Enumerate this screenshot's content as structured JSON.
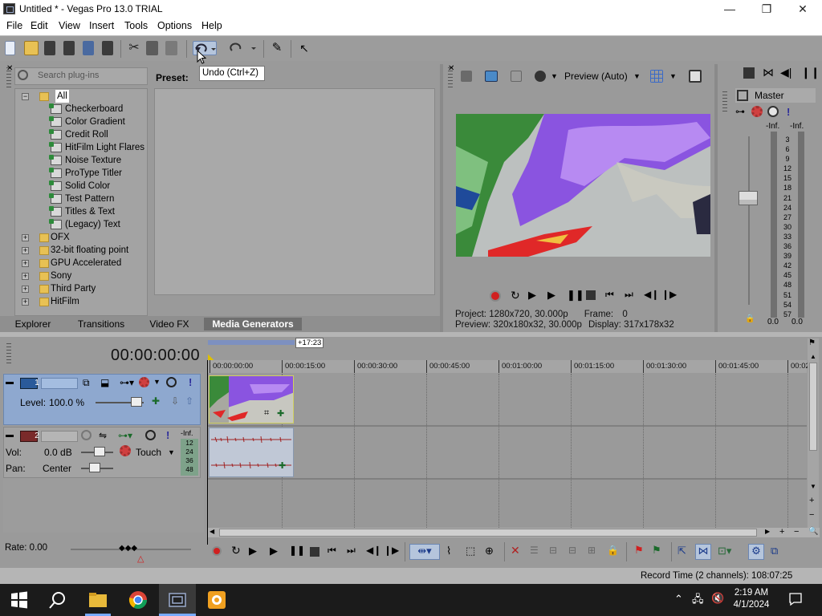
{
  "window": {
    "title": "Untitled * - Vegas Pro 13.0 TRIAL",
    "minimize": "—",
    "maximize": "❐",
    "close": "✕"
  },
  "menu": [
    "File",
    "Edit",
    "View",
    "Insert",
    "Tools",
    "Options",
    "Help"
  ],
  "tooltip": "Undo (Ctrl+Z)",
  "explorer": {
    "search_placeholder": "Search plug-ins",
    "preset_label": "Preset:",
    "tree": {
      "root": "All",
      "children": [
        "Checkerboard",
        "Color Gradient",
        "Credit Roll",
        "HitFilm Light Flares",
        "Noise Texture",
        "ProType Titler",
        "Solid Color",
        "Test Pattern",
        "Titles & Text",
        "(Legacy) Text"
      ],
      "folders": [
        "OFX",
        "32-bit floating point",
        "GPU Accelerated",
        "Sony",
        "Third Party",
        "HitFilm"
      ]
    },
    "tabs": [
      "Explorer",
      "Transitions",
      "Video FX",
      "Media Generators"
    ],
    "active_tab": "Media Generators"
  },
  "preview": {
    "mode": "Preview (Auto)",
    "project_label": "Project:",
    "project_value": "1280x720, 30.000p",
    "preview_label": "Preview:",
    "preview_value": "320x180x32, 30.000p",
    "frame_label": "Frame:",
    "frame_value": "0",
    "display_label": "Display:",
    "display_value": "317x178x32"
  },
  "master": {
    "label": "Master",
    "inf_left": "-Inf.",
    "inf_right": "-Inf.",
    "scale": [
      "3",
      "6",
      "9",
      "12",
      "15",
      "18",
      "21",
      "24",
      "27",
      "30",
      "33",
      "36",
      "39",
      "42",
      "45",
      "48",
      "51",
      "54",
      "57"
    ],
    "bottom_left": "0.0",
    "bottom_right": "0.0"
  },
  "timeline": {
    "timecode": "00:00:00:00",
    "loop_marker": "+17:23",
    "ruler": [
      "00:00:00:00",
      "00:00:15:00",
      "00:00:30:00",
      "00:00:45:00",
      "00:01:00:00",
      "00:01:15:00",
      "00:01:30:00",
      "00:01:45:00",
      "00:02"
    ],
    "track1": {
      "number": "1",
      "level_label": "Level:",
      "level_value": "100.0 %"
    },
    "track2": {
      "number": "2",
      "vol_label": "Vol:",
      "vol_value": "0.0 dB",
      "pan_label": "Pan:",
      "pan_value": "Center",
      "automation": "Touch",
      "meter_inf": "-Inf.",
      "meter_scale": [
        "12",
        "24",
        "36",
        "48"
      ]
    },
    "rate": "Rate: 0.00"
  },
  "status": {
    "record_time": "Record Time (2 channels): 108:07:25"
  },
  "taskbar": {
    "time": "2:19 AM",
    "date": "4/1/2024"
  },
  "colors": {
    "panel_bg": "#9c9c9c",
    "active_tab": "#6f6f6f",
    "track1_header": "#8ea8cf",
    "record_red": "#d02020"
  }
}
